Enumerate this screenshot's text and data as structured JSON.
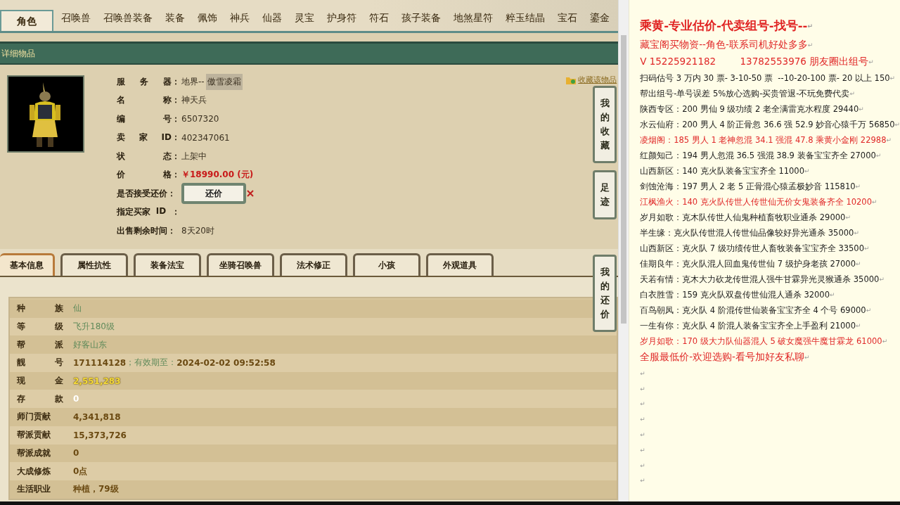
{
  "top_tabs": [
    {
      "label": "角色",
      "selected": true
    },
    {
      "label": "召唤兽",
      "selected": false
    },
    {
      "label": "召唤兽装备",
      "selected": false
    },
    {
      "label": "装备",
      "selected": false
    },
    {
      "label": "佩饰",
      "selected": false
    },
    {
      "label": "神兵",
      "selected": false
    },
    {
      "label": "仙器",
      "selected": false
    },
    {
      "label": "灵宝",
      "selected": false
    },
    {
      "label": "护身符",
      "selected": false
    },
    {
      "label": "符石",
      "selected": false
    },
    {
      "label": "孩子装备",
      "selected": false
    },
    {
      "label": "地煞星符",
      "selected": false
    },
    {
      "label": "粹玉结晶",
      "selected": false
    },
    {
      "label": "宝石",
      "selected": false
    },
    {
      "label": "鎏金",
      "selected": false
    }
  ],
  "section_bar": {
    "title": "详细物品"
  },
  "item": {
    "favorite_link": "收藏该物品",
    "fields": [
      {
        "label": "服 务 器：",
        "kind": "text",
        "parts": [
          {
            "text": "地界--",
            "kind": "plain"
          },
          {
            "text": "傲雪凌霜",
            "kind": "highlight"
          }
        ]
      },
      {
        "label": "名 称：",
        "kind": "text",
        "parts": [
          {
            "text": "神天兵",
            "kind": "plain"
          }
        ]
      },
      {
        "label": "编 号：",
        "kind": "text",
        "parts": [
          {
            "text": "6507320",
            "kind": "plain"
          }
        ]
      },
      {
        "label": "卖 家 ID：",
        "kind": "text",
        "parts": [
          {
            "text": "402347061",
            "kind": "plain"
          }
        ]
      },
      {
        "label": "状 态：",
        "kind": "text",
        "parts": [
          {
            "text": "上架中",
            "kind": "plain"
          }
        ]
      },
      {
        "label": "价 格：",
        "kind": "text",
        "parts": [
          {
            "text": "￥18990.00 (元)",
            "kind": "price"
          }
        ]
      },
      {
        "label": "是否接受还价：",
        "kind": "button",
        "button": "还价"
      },
      {
        "label": "指定买家 ID ：",
        "kind": "text"
      },
      {
        "label": "出售剩余时间：",
        "kind": "text",
        "parts": [
          {
            "text": "8天20时",
            "kind": "plain"
          }
        ]
      }
    ]
  },
  "side_buttons": [
    {
      "label": "我的收藏"
    },
    {
      "label": "足迹"
    },
    {
      "label": "我的还价"
    }
  ],
  "sub_tabs": [
    {
      "label": "基本信息",
      "selected": true
    },
    {
      "label": "属性抗性",
      "selected": false
    },
    {
      "label": "装备法宝",
      "selected": false
    },
    {
      "label": "坐骑召唤兽",
      "selected": false
    },
    {
      "label": "法术修正",
      "selected": false
    },
    {
      "label": "小孩",
      "selected": false
    },
    {
      "label": "外观道具",
      "selected": false
    }
  ],
  "table": {
    "rows": [
      {
        "label": "种 族",
        "parts": [
          {
            "text": "仙",
            "kind": "muted"
          }
        ]
      },
      {
        "label": "等 级",
        "parts": [
          {
            "text": "飞升180级",
            "kind": "muted"
          }
        ]
      },
      {
        "label": "帮 派",
        "parts": [
          {
            "text": "好客山东",
            "kind": "muted"
          }
        ]
      },
      {
        "label": "靓 号",
        "parts": [
          {
            "text": "171114128",
            "kind": "bold"
          },
          {
            "text": "；有效期至：",
            "kind": "muted"
          },
          {
            "text": "2024-02-02 09:52:58",
            "kind": "bold"
          }
        ]
      },
      {
        "label": "现 金",
        "parts": [
          {
            "text": "2,551,283",
            "kind": "gold"
          }
        ]
      },
      {
        "label": "存 款",
        "parts": [
          {
            "text": "0",
            "kind": "white"
          }
        ]
      },
      {
        "label": "师门贡献",
        "parts": [
          {
            "text": "4,341,818",
            "kind": "bold"
          }
        ]
      },
      {
        "label": "帮派贡献",
        "parts": [
          {
            "text": "15,373,726",
            "kind": "bold"
          }
        ]
      },
      {
        "label": "帮派成就",
        "parts": [
          {
            "text": "0",
            "kind": "bold"
          }
        ]
      },
      {
        "label": "大成修炼",
        "parts": [
          {
            "text": "0点",
            "kind": "bold"
          }
        ]
      },
      {
        "label": "生活职业",
        "parts": [
          {
            "text": "种植，79级",
            "kind": "bold"
          }
        ]
      }
    ]
  },
  "notes": {
    "lines": [
      {
        "text": "乘黄-专业估价-代卖组号-找号--",
        "kind": "heading",
        "mark": "↵"
      },
      {
        "text": "藏宝阁买物资--角色-联系司机好处多多",
        "kind": "lead",
        "mark": "↵"
      },
      {
        "text": "V 15225921182        13782553976 朋友圈出组号",
        "kind": "lead",
        "mark": "↵"
      },
      {
        "text": "扫码估号 3 万内 30 票- 3-10-50 票  --10-20-100 票- 20 以上 150",
        "kind": "plain",
        "mark": "↵"
      },
      {
        "text": "帮出组号-单号误差 5%放心选购-买贵管退-不玩免费代卖",
        "kind": "plain",
        "mark": "↵"
      },
      {
        "text": "陕西专区：200 男仙 9 级功绩 2 老全满雷克水程度 29440",
        "kind": "plain",
        "mark": "↵"
      },
      {
        "text": "水云仙府：200 男人 4 阶正骨忽 36.6 强 52.9 妙音心猿千万 56850",
        "kind": "plain",
        "mark": "↵"
      },
      {
        "text": "凌烟阁：185 男人 1 老神忽混 34.1 强混 47.8 乘黄小金刚 22988",
        "kind": "red",
        "mark": "↵"
      },
      {
        "text": "红颜知己：194 男人忽混 36.5 强混 38.9 装备宝宝齐全 27000",
        "kind": "plain",
        "mark": "↵"
      },
      {
        "text": "山西新区：140 克火队装备宝宝齐全 11000",
        "kind": "plain",
        "mark": "↵"
      },
      {
        "text": "剑蚀沧海：197 男人 2 老 5 正骨混心猿孟极妙音 115810",
        "kind": "plain",
        "mark": "↵"
      },
      {
        "text": "江枫渔火：140 克火队传世人传世仙无价女鬼装备齐全 10200",
        "kind": "red",
        "mark": "↵"
      },
      {
        "text": "岁月如歌：克木队传世人仙鬼种植畜牧职业通杀 29000",
        "kind": "plain",
        "mark": "↵"
      },
      {
        "text": "半生缘：克火队传世混人传世仙品像较好异光通杀 35000",
        "kind": "plain",
        "mark": "↵"
      },
      {
        "text": "山西新区：克火队 7 级功绩传世人畜牧装备宝宝齐全 33500",
        "kind": "plain",
        "mark": "↵"
      },
      {
        "text": "佳期良年：克火队混人回血鬼传世仙 7 级护身老孩 27000",
        "kind": "plain",
        "mark": "↵"
      },
      {
        "text": "天若有情：克木大力砍龙传世混人强牛甘霖异光灵猴通杀 35000",
        "kind": "plain",
        "mark": "↵"
      },
      {
        "text": "白衣胜雪：159 克火队双盘传世仙混人通杀 32000",
        "kind": "plain",
        "mark": "↵"
      },
      {
        "text": "百鸟朝凤：克火队 4 阶混传世仙装备宝宝齐全 4 个号 69000",
        "kind": "plain",
        "mark": "↵"
      },
      {
        "text": "一生有你：克火队 4 阶混人装备宝宝齐全上手盈利 21000",
        "kind": "plain",
        "mark": "↵"
      },
      {
        "text": "岁月如歌：170 级大力队仙器混人 5 破女魔强牛魔甘霖龙 61000",
        "kind": "red",
        "mark": "↵"
      },
      {
        "text": "全服最低价-欢迎选购-看号加好友私聊",
        "kind": "lead",
        "mark": "↵"
      }
    ],
    "blank_marks": [
      "↵",
      "↵",
      "↵",
      "↵",
      "↵",
      "↵",
      "↵",
      "↵"
    ]
  }
}
